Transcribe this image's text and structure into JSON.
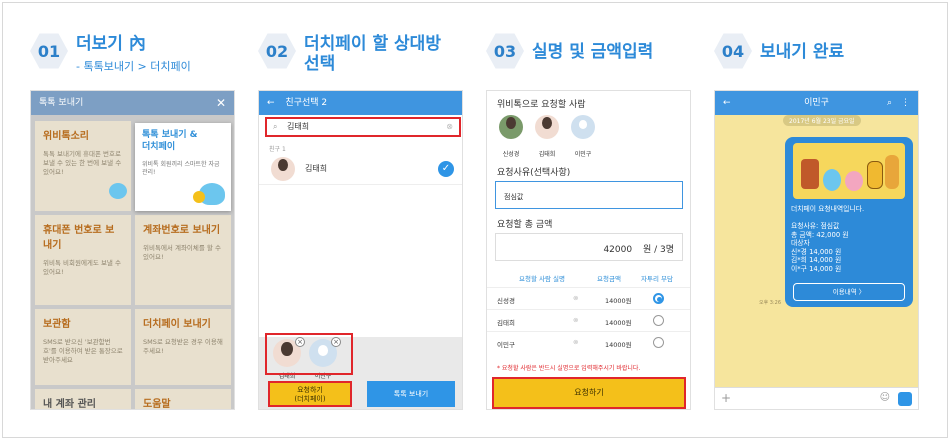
{
  "steps": [
    {
      "num": "01",
      "title": "더보기 內",
      "sub": "- 톡톡보내기 > 더치페이"
    },
    {
      "num": "02",
      "title": "더치페이 할 상대방",
      "title2": "선택"
    },
    {
      "num": "03",
      "title": "실명 및 금액입력"
    },
    {
      "num": "04",
      "title": "보내기 완료"
    }
  ],
  "p1": {
    "header": "톡톡 보내기",
    "tiles": [
      {
        "t": "위비톡소리",
        "d": "톡톡 보내기에 휴대폰 번호로 보낼 수 있는 한 번에 보낼 수 있어요!"
      },
      {
        "t": "휴대폰 번호로 보내기",
        "d": "위비톡 비회원에게도 보낼 수 있어요!"
      },
      {
        "t": "계좌번호로 보내기",
        "d": "위비톡에서 계좌이체를 할 수 있어요!"
      },
      {
        "t": "보관함",
        "d": "SMS로 받으신 '보관함번호'를 이용하여 받은 통장으로 받아주세요"
      },
      {
        "t": "더치페이 보내기",
        "d": "SMS로 요청받은 경우 이용해주세요!"
      },
      {
        "t": "내 계좌 관리",
        "d": ""
      },
      {
        "t": "도움말",
        "d": ""
      }
    ],
    "popup": {
      "title1": "톡톡 보내기 &",
      "title2": "더치페이",
      "desc": "위비톡 회원끼리 스마트한 자금관리!"
    }
  },
  "p2": {
    "header": "친구선택 2",
    "search": "김태희",
    "label": "친구 1",
    "friend": "김태희",
    "selected": [
      {
        "name": "김태희"
      },
      {
        "name": "이민구"
      }
    ],
    "req1": "요청하기",
    "req2": "(더치페이)",
    "send": "톡톡 보내기"
  },
  "p3": {
    "title": "위비톡으로 요청할 사람",
    "people": [
      "신성경",
      "김태희",
      "이민구"
    ],
    "reason_label": "요청사유(선택사항)",
    "reason": "점심값",
    "amount_label": "요청할 총 금액",
    "amount": "42000",
    "amount_unit": "원 / 3명",
    "col1": "요청할 사람 실명",
    "col2": "요청금액",
    "col3": "자투리 부담",
    "rows": [
      {
        "name": "신성경",
        "amt": "14000원",
        "on": true
      },
      {
        "name": "김태희",
        "amt": "14000원",
        "on": false
      },
      {
        "name": "이민구",
        "amt": "14000원",
        "on": false
      }
    ],
    "notice": "* 요청할 사람은 반드시 실명으로 입력해주시기 바랍니다.",
    "button": "요청하기"
  },
  "p4": {
    "header": "이민구",
    "date": "2017년 6월 23일 금요일",
    "lines": "더치페이 요청내역입니다.\n\n요청사유: 점심값\n총 금액: 42,000 원\n대상자\n신*경 14,000 원\n김*희 14,000 원\n이*구 14,000 원",
    "button": "이용내역  〉",
    "time": "오후 3:26"
  },
  "colors": {
    "accent": "#2d8ad8",
    "highlight": "#e0262b",
    "yellow": "#f4c01a"
  }
}
